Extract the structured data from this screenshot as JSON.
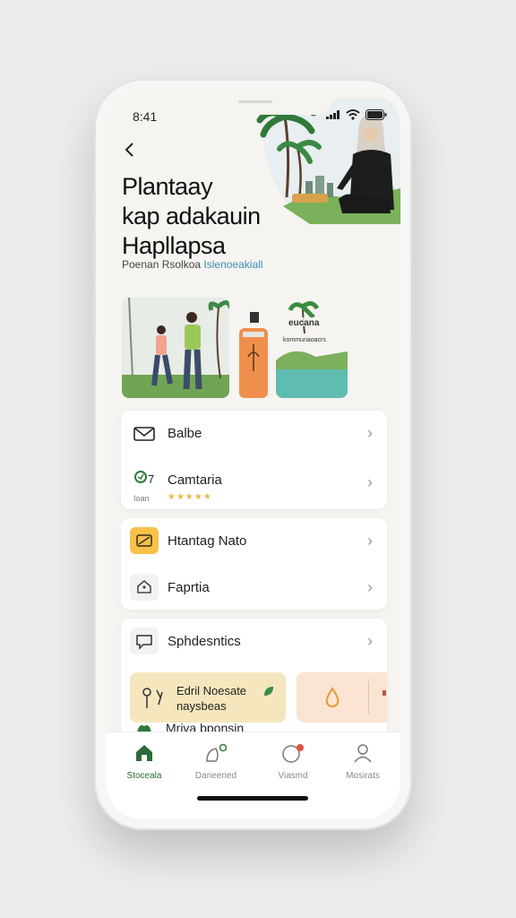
{
  "status": {
    "time": "8:41"
  },
  "header": {
    "title": "Plantaay\nkap adakauin\nHapllapsa",
    "subtitle_text": "Poenan Rsolkoa",
    "subtitle_link": "Islenoeakiall"
  },
  "gallery": {
    "tile3_caption_line1": "eucana",
    "tile3_caption_line2": "kommunaoacrs"
  },
  "list": {
    "item1_label": "Balbe",
    "item2_label": "Camtaria",
    "item2_badge": "7",
    "item2_rating_caption": "Ioan",
    "item2_stars": "★★★★★",
    "item3_label": "Htantag Nato",
    "item4_label": "Faprtia",
    "item5_label": "Sphdesntics"
  },
  "promo": {
    "line1": "Edril Noesate",
    "line2": "naysbeas"
  },
  "partial_row": {
    "label": "Mriva bponsin"
  },
  "tabs": [
    {
      "label": "Stoceala",
      "icon": "home-icon"
    },
    {
      "label": "Darieened",
      "icon": "plant-icon"
    },
    {
      "label": "Viasmd",
      "icon": "chat-icon"
    },
    {
      "label": "Mosirats",
      "icon": "profile-icon"
    }
  ],
  "colors": {
    "accent_green": "#2d6b3a",
    "promo_yellow": "#f5e6be",
    "promo_peach": "#fbe4d2",
    "link_blue": "#3c8fb4",
    "star": "#e8b94a"
  }
}
